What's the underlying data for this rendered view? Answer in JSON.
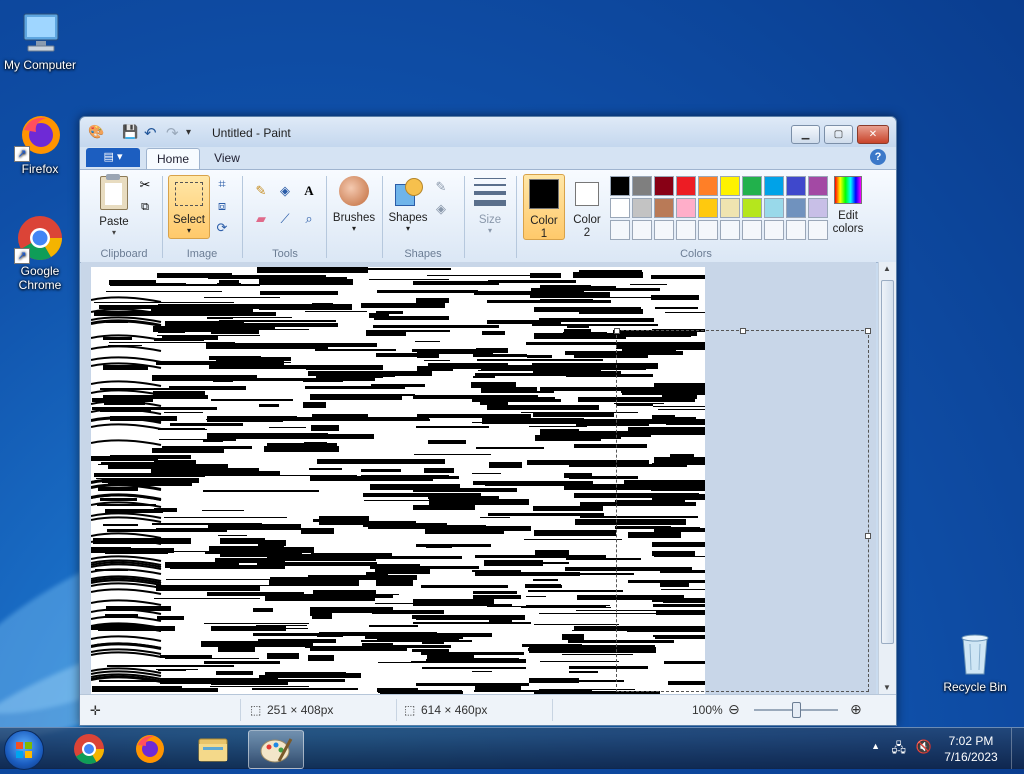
{
  "desktop": {
    "icons": [
      {
        "label": "My Computer"
      },
      {
        "label": "Firefox"
      },
      {
        "label": "Google Chrome"
      },
      {
        "label": "Recycle Bin"
      }
    ]
  },
  "window": {
    "title": "Untitled - Paint",
    "tabs": [
      {
        "label": "Home"
      },
      {
        "label": "View"
      }
    ],
    "ribbon": {
      "clipboard": {
        "paste_label": "Paste",
        "group_label": "Clipboard"
      },
      "image": {
        "select_label": "Select",
        "group_label": "Image"
      },
      "tools": {
        "group_label": "Tools"
      },
      "brushes": {
        "label": "Brushes"
      },
      "shapes": {
        "label": "Shapes",
        "group_label": "Shapes"
      },
      "size": {
        "label": "Size"
      },
      "color1": {
        "label": "Color 1",
        "color": "#000000"
      },
      "color2": {
        "label": "Color 2",
        "color": "#ffffff"
      },
      "colors_group_label": "Colors",
      "edit_colors_label": "Edit colors",
      "palette_row1": [
        "#000000",
        "#7f7f7f",
        "#880015",
        "#ed1c24",
        "#ff7f27",
        "#fff200",
        "#22b14c",
        "#00a2e8",
        "#3f48cc",
        "#a349a4"
      ],
      "palette_row2": [
        "#ffffff",
        "#c3c3c3",
        "#b97a57",
        "#ffaec9",
        "#ffc90e",
        "#efe4b0",
        "#b5e61d",
        "#99d9ea",
        "#7092be",
        "#c8bfe7"
      ]
    },
    "status": {
      "selection_size": "251 × 408px",
      "image_size": "614 × 460px",
      "zoom": "100%"
    }
  },
  "taskbar": {
    "time": "7:02 PM",
    "date": "7/16/2023"
  }
}
